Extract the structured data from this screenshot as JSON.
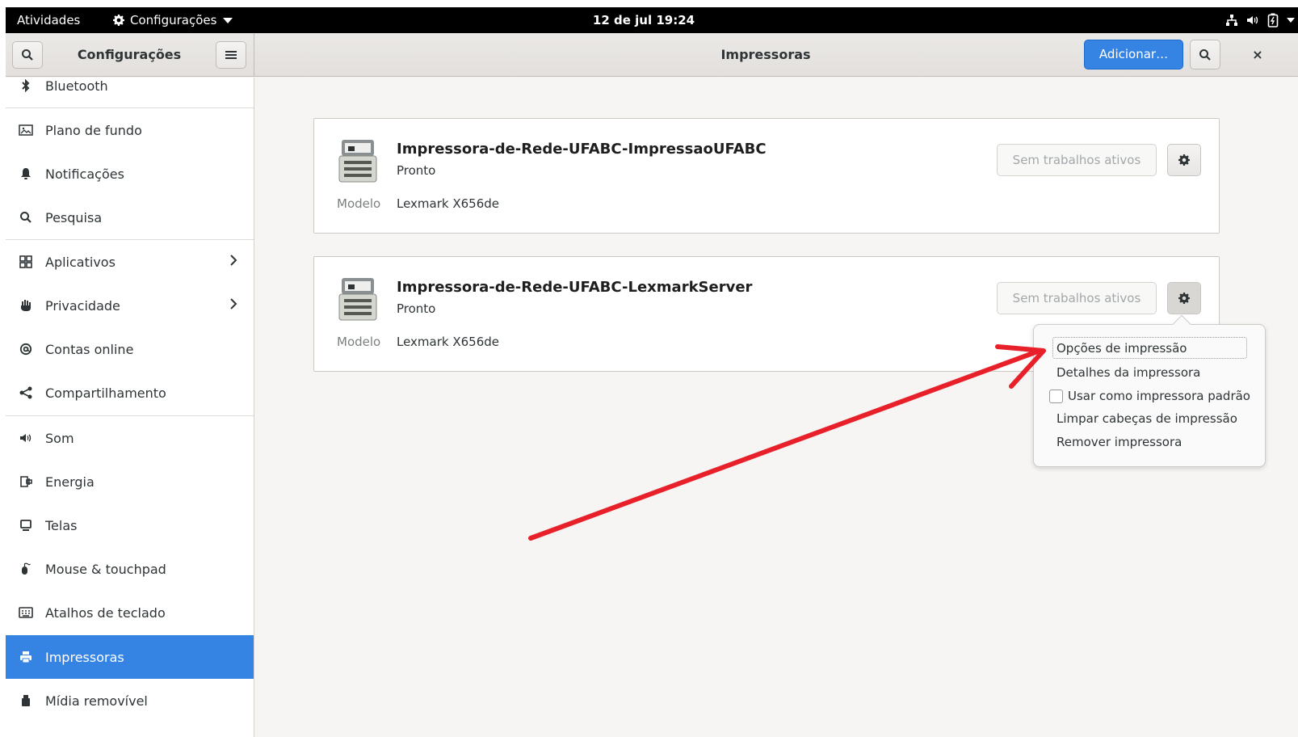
{
  "top_bar": {
    "activities": "Atividades",
    "app_menu": "Configurações",
    "clock": "12 de jul 19:24"
  },
  "header": {
    "sidebar_title": "Configurações",
    "main_title": "Impressoras",
    "add_button": "Adicionar…",
    "close_glyph": "×"
  },
  "sidebar": {
    "items": [
      {
        "label": "Bluetooth",
        "icon": "bluetooth-icon"
      },
      {
        "label": "Plano de fundo",
        "icon": "image-icon"
      },
      {
        "label": "Notificações",
        "icon": "bell-icon"
      },
      {
        "label": "Pesquisa",
        "icon": "search-icon"
      },
      {
        "label": "Aplicativos",
        "icon": "apps-grid-icon"
      },
      {
        "label": "Privacidade",
        "icon": "hand-icon"
      },
      {
        "label": "Contas online",
        "icon": "at-icon"
      },
      {
        "label": "Compartilhamento",
        "icon": "share-icon"
      },
      {
        "label": "Som",
        "icon": "speaker-icon"
      },
      {
        "label": "Energia",
        "icon": "battery-icon"
      },
      {
        "label": "Telas",
        "icon": "monitor-icon"
      },
      {
        "label": "Mouse & touchpad",
        "icon": "mouse-icon"
      },
      {
        "label": "Atalhos de teclado",
        "icon": "keyboard-icon"
      },
      {
        "label": "Impressoras",
        "icon": "printer-icon",
        "selected": true
      },
      {
        "label": "Mídia removível",
        "icon": "usb-icon"
      }
    ]
  },
  "printers": [
    {
      "name": "Impressora-de-Rede-UFABC-ImpressaoUFABC",
      "status": "Pronto",
      "model_label": "Modelo",
      "model": "Lexmark X656de",
      "jobs_button": "Sem trabalhos ativos"
    },
    {
      "name": "Impressora-de-Rede-UFABC-LexmarkServer",
      "status": "Pronto",
      "model_label": "Modelo",
      "model": "Lexmark X656de",
      "jobs_button": "Sem trabalhos ativos"
    }
  ],
  "popover": {
    "items": [
      "Opções de impressão",
      "Detalhes da impressora",
      "Usar como impressora padrão",
      "Limpar cabeças de impressão",
      "Remover impressora"
    ],
    "default_printer_checked": false
  },
  "colors": {
    "accent": "#3584e4",
    "annotation_arrow": "#e8202a"
  }
}
